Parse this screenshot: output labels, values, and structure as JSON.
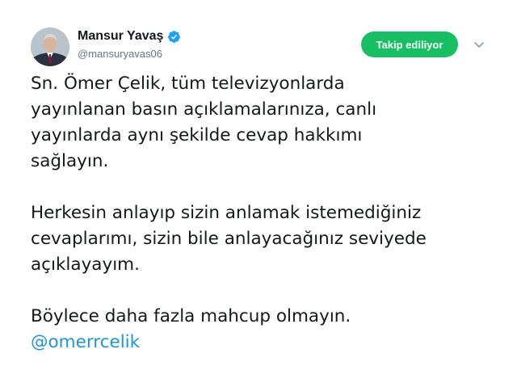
{
  "user": {
    "name": "Mansur Yavaş",
    "handle": "@mansuryavas06"
  },
  "icons": {
    "verified": "verified-badge-icon",
    "caret": "chevron-down-icon",
    "verified_color": "#1da1f2"
  },
  "follow_button": {
    "label": "Takip ediliyor",
    "color": "#17bf63"
  },
  "tweet": {
    "paragraphs": [
      {
        "lines": [
          "Sn. Ömer Çelik, tüm televizyonlarda",
          "yayınlanan basın açıklamalarınıza, canlı",
          "yayınlarda aynı şekilde cevap hakkımı",
          "sağlayın."
        ]
      },
      {
        "lines": [
          "Herkesin anlayıp sizin anlamak istemediğiniz",
          "cevaplarımı, sizin bile anlayacağınız seviyede",
          "açıklayayım."
        ]
      },
      {
        "lines": [
          "Böylece daha fazla mahcup olmayın."
        ]
      }
    ],
    "mention": "@omerrcelik",
    "mention_color": "#1b95e0"
  }
}
